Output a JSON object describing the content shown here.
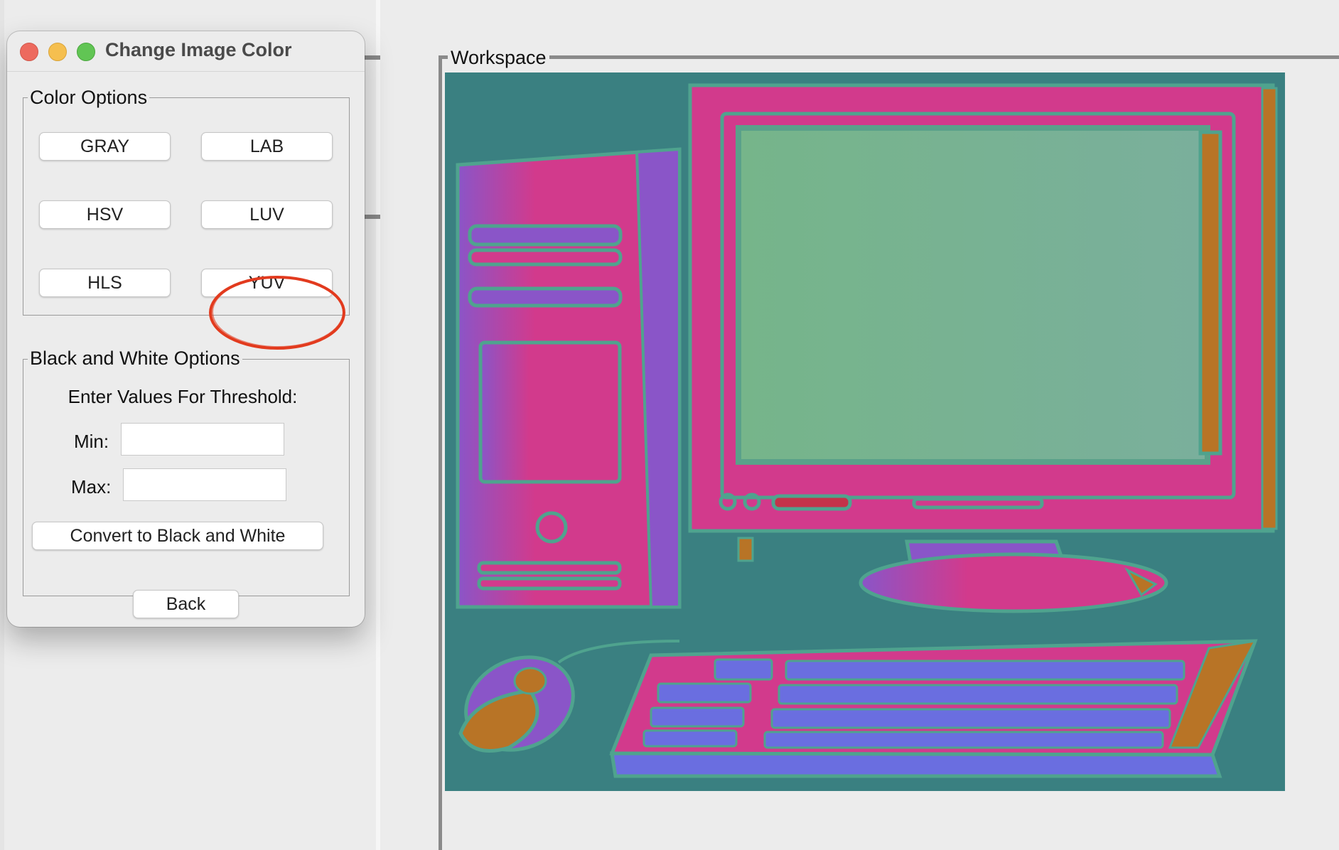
{
  "dialog": {
    "title": "Change Image Color",
    "color_options": {
      "label": "Color Options",
      "buttons": [
        "GRAY",
        "LAB",
        "HSV",
        "LUV",
        "HLS",
        "YUV"
      ]
    },
    "bw_options": {
      "label": "Black and White Options",
      "prompt": "Enter Values For Threshold:",
      "min_label": "Min:",
      "max_label": "Max:",
      "min_value": "",
      "max_value": "",
      "convert_label": "Convert to Black and White"
    },
    "back_label": "Back",
    "highlight": "YUV"
  },
  "workspace": {
    "label": "Workspace",
    "image_subject": "desktop computer illustration in false color"
  },
  "colors": {
    "background": "#ececec",
    "image_teal": "#3a8081",
    "image_pink": "#d23a8c",
    "image_purple": "#8a55c8",
    "screen_green": "#7db59a",
    "accent_orange": "#b87426",
    "annotation_red": "#e23b1e"
  }
}
